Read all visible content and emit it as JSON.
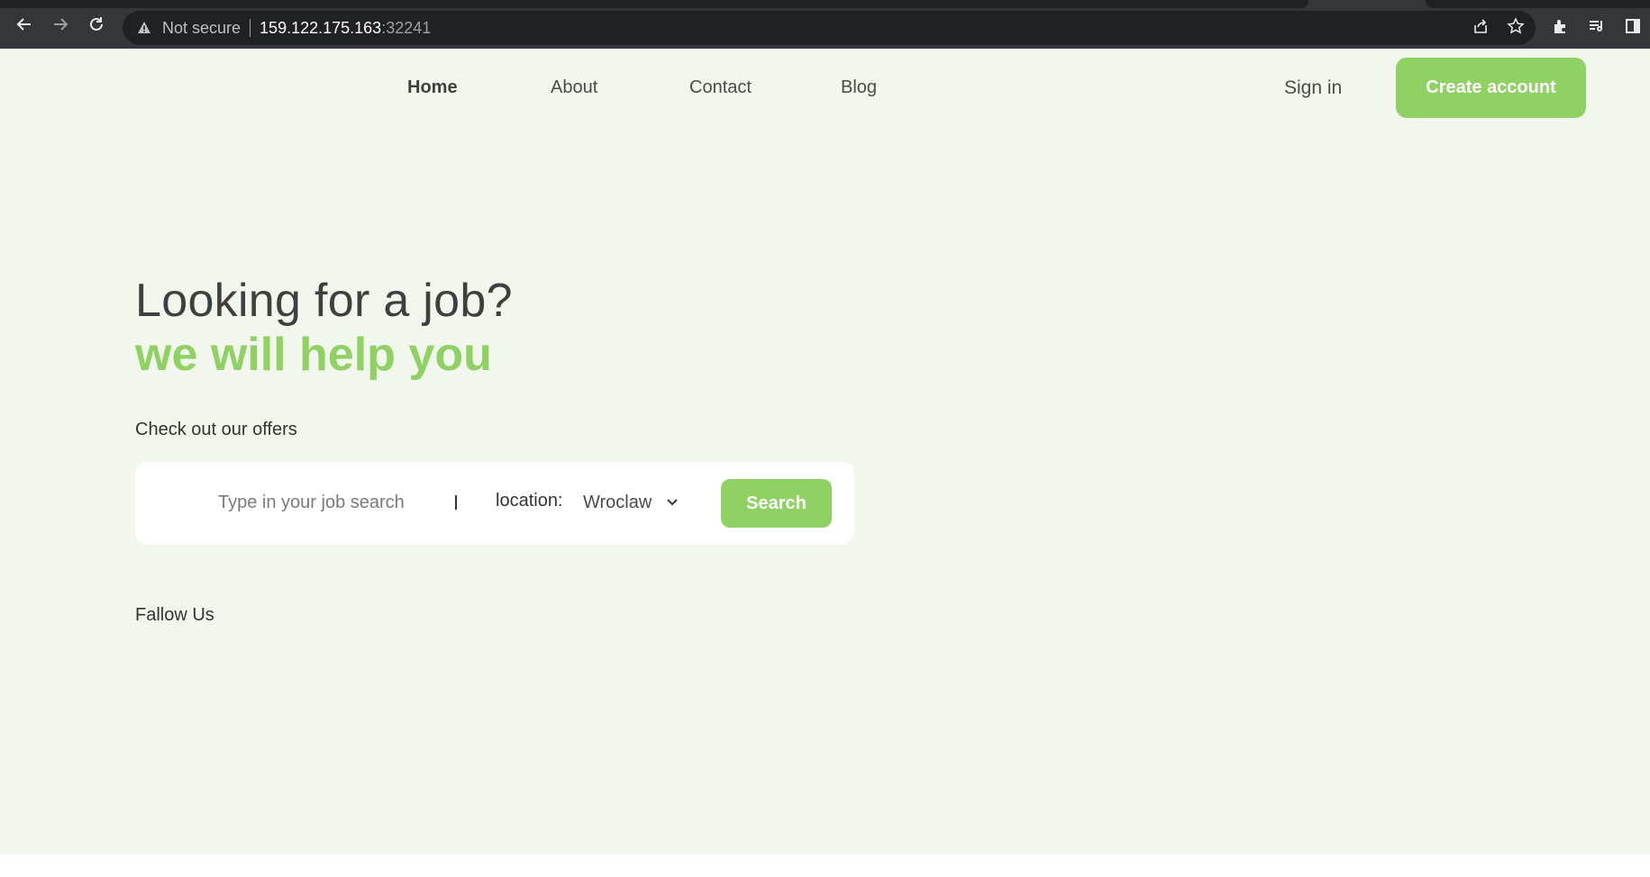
{
  "browser": {
    "security_label": "Not secure",
    "url_host": "159.122.175.163",
    "url_port": ":32241",
    "icons": [
      "back-arrow-icon",
      "forward-arrow-icon",
      "reload-icon",
      "warning-icon",
      "share-icon",
      "star-icon",
      "extensions-icon",
      "media-list-icon",
      "side-panel-icon"
    ]
  },
  "nav": {
    "home": "Home",
    "about": "About",
    "contact": "Contact",
    "blog": "Blog",
    "sign_in": "Sign in",
    "create_account": "Create account"
  },
  "hero": {
    "title": "Looking for a job?",
    "subtitle": "we will help you"
  },
  "search": {
    "section_label": "Check out our offers",
    "placeholder": "Type in your job search",
    "value": "",
    "location_label": "location:",
    "location_value": "Wroclaw",
    "button": "Search"
  },
  "footer": {
    "follow_label": "Fallow Us"
  },
  "colors": {
    "accent": "#8fd163",
    "page_bg": "#f1f7ec",
    "text_dark": "#3f3f3f"
  }
}
